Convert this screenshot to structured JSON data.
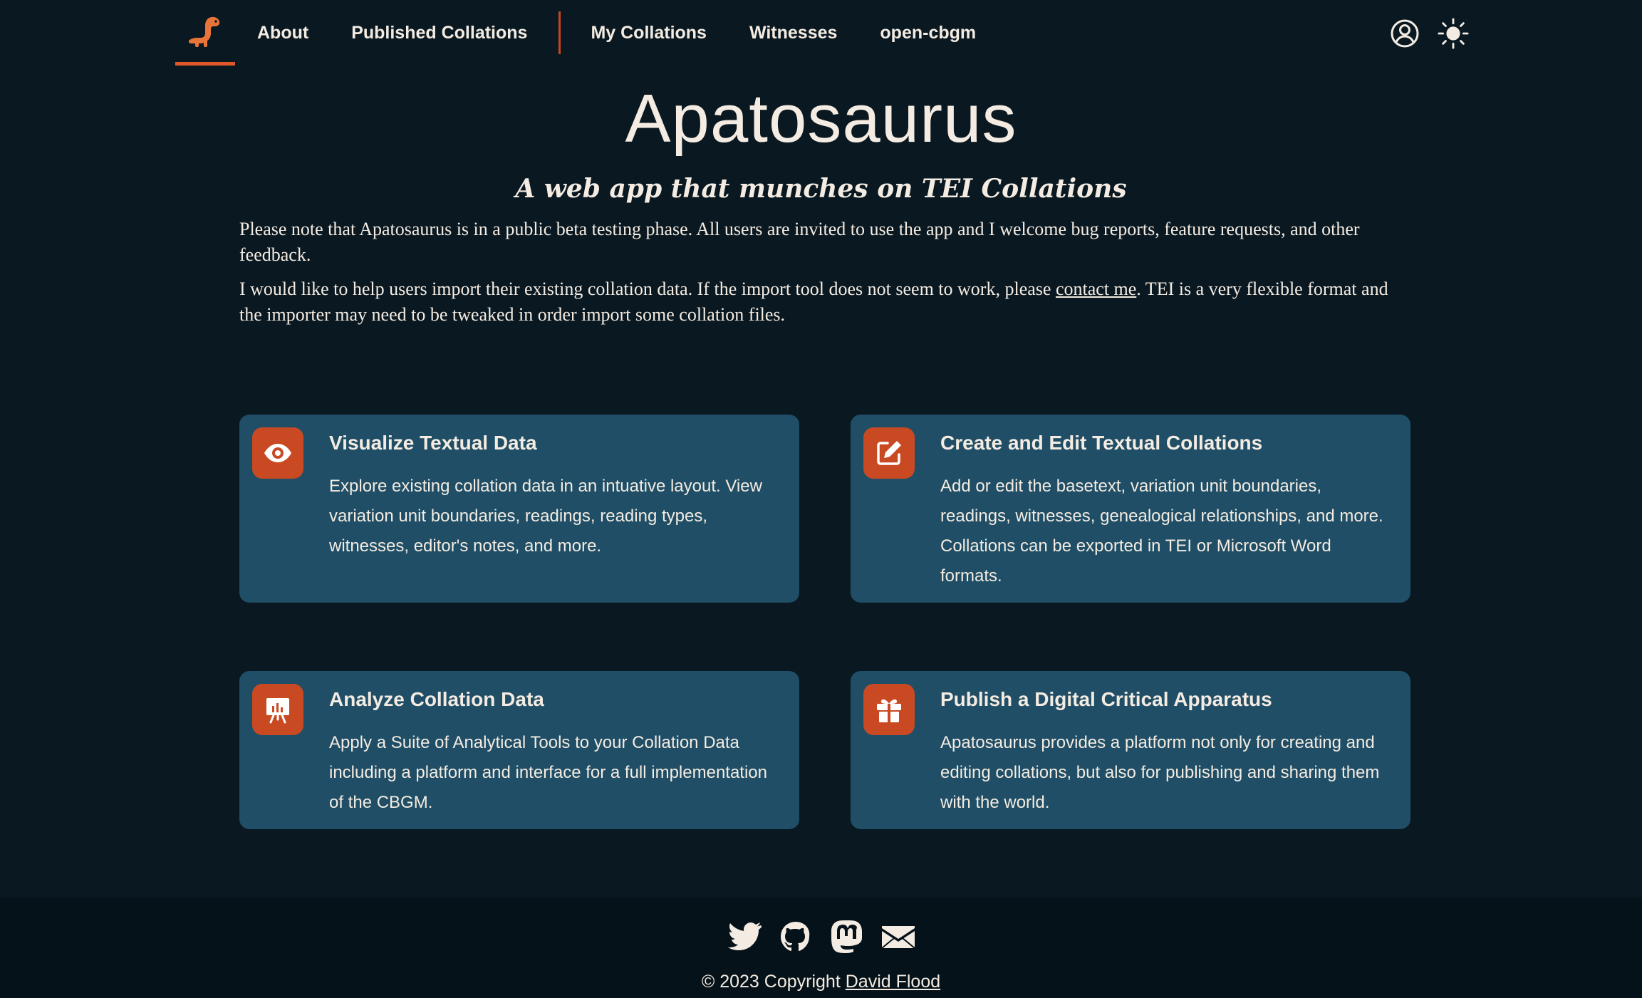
{
  "nav": {
    "logo_icon": "apatosaurus-logo-icon",
    "links": [
      "About",
      "Published Collations",
      "My Collations",
      "Witnesses",
      "open-cbgm"
    ],
    "account_icon": "user-circle-icon",
    "theme_icon": "sun-icon"
  },
  "hero": {
    "title": "Apatosaurus",
    "subtitle": "A web app that munches on TEI Collations",
    "intro_1": "Please note that Apatosaurus is in a public beta testing phase. All users are invited to use the app and I welcome bug reports, feature requests, and other feedback.",
    "intro_2_before": "I would like to help users import their existing collation data. If the import tool does not seem to work, please ",
    "intro_2_link": "contact me",
    "intro_2_after": ". TEI is a very flexible format and the importer may need to be tweaked in order import some collation files."
  },
  "cards": [
    {
      "icon": "eye-icon",
      "title": "Visualize Textual Data",
      "text": "Explore existing collation data in an intuative layout. View variation unit boundaries, readings, reading types, witnesses, editor's notes, and more."
    },
    {
      "icon": "edit-icon",
      "title": "Create and Edit Textual Collations",
      "text": "Add or edit the basetext, variation unit boundaries, readings, witnesses, genealogical relationships, and more. Collations can be exported in TEI or Microsoft Word formats."
    },
    {
      "icon": "presentation-chart-icon",
      "title": "Analyze Collation Data",
      "text": "Apply a Suite of Analytical Tools to your Collation Data including a platform and interface for a full implementation of the CBGM."
    },
    {
      "icon": "gift-icon",
      "title": "Publish a Digital Critical Apparatus",
      "text": "Apatosaurus provides a platform not only for creating and editing collations, but also for publishing and sharing them with the world."
    }
  ],
  "footer": {
    "icons": [
      "twitter-icon",
      "github-icon",
      "mastodon-icon",
      "email-icon"
    ],
    "copyright_prefix": "© 2023 Copyright ",
    "copyright_name": "David Flood"
  },
  "colors": {
    "background": "#0a1821",
    "card": "#1f4e66",
    "accent": "#c94a22",
    "text": "#f4ece2"
  }
}
